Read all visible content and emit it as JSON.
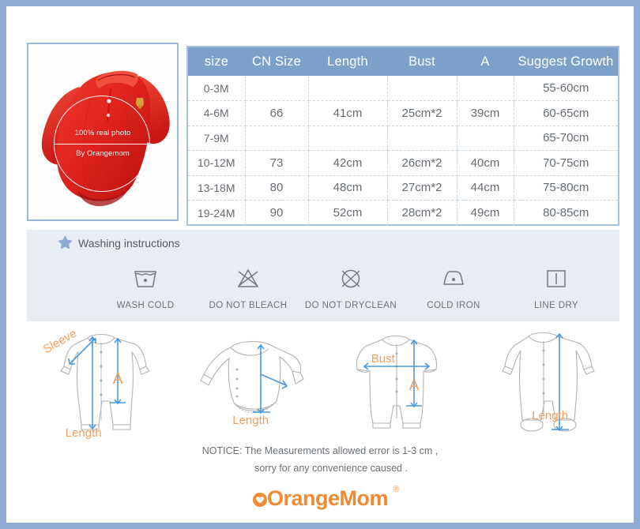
{
  "photo": {
    "alt": "red baby polo romper",
    "watermark_line1": "100% real photo",
    "watermark_line2": "By Orangemom"
  },
  "table": {
    "headers": [
      "size",
      "CN Size",
      "Length",
      "Bust",
      "A",
      "Suggest Growth"
    ],
    "rows": [
      [
        "0-3M",
        "",
        "",
        "",
        "",
        "55-60cm"
      ],
      [
        "4-6M",
        "66",
        "41cm",
        "25cm*2",
        "39cm",
        "60-65cm"
      ],
      [
        "7-9M",
        "",
        "",
        "",
        "",
        "65-70cm"
      ],
      [
        "10-12M",
        "73",
        "42cm",
        "26cm*2",
        "40cm",
        "70-75cm"
      ],
      [
        "13-18M",
        "80",
        "48cm",
        "27cm*2",
        "44cm",
        "75-80cm"
      ],
      [
        "19-24M",
        "90",
        "52cm",
        "28cm*2",
        "49cm",
        "80-85cm"
      ]
    ]
  },
  "washing": {
    "title": "Washing instructions",
    "items": [
      {
        "icon": "wash-cold-icon",
        "label": "WASH COLD"
      },
      {
        "icon": "do-not-bleach-icon",
        "label": "DO NOT BLEACH"
      },
      {
        "icon": "do-not-dryclean-icon",
        "label": "DO NOT DRYCLEAN"
      },
      {
        "icon": "cold-iron-icon",
        "label": "COLD IRON"
      },
      {
        "icon": "line-dry-icon",
        "label": "LINE DRY"
      }
    ]
  },
  "diagrams": [
    {
      "name": "long-sleeve-romper",
      "labels": {
        "a": "Sleeve",
        "b": "A",
        "c": "Length"
      }
    },
    {
      "name": "long-sleeve-bodysuit",
      "labels": {
        "c": "Length"
      }
    },
    {
      "name": "short-sleeve-romper",
      "labels": {
        "a": "Bust",
        "b": "A"
      }
    },
    {
      "name": "footed-sleepsuit",
      "labels": {
        "c": "Length"
      }
    }
  ],
  "notice": {
    "line1": "NOTICE:   The Measurements allowed error is 1-3 cm ,",
    "line2": "sorry for any convenience caused ."
  },
  "logo": {
    "text": "OrangeMom",
    "registered": "®"
  },
  "colors": {
    "frame": "#8fabd4",
    "header_blue": "#7da0ca",
    "wash_bg": "#e8edf5",
    "label_orange": "#f0a060",
    "arrow_blue": "#4b9ae0",
    "garment_red": "#e0231f",
    "logo_orange": "#f08a33"
  }
}
